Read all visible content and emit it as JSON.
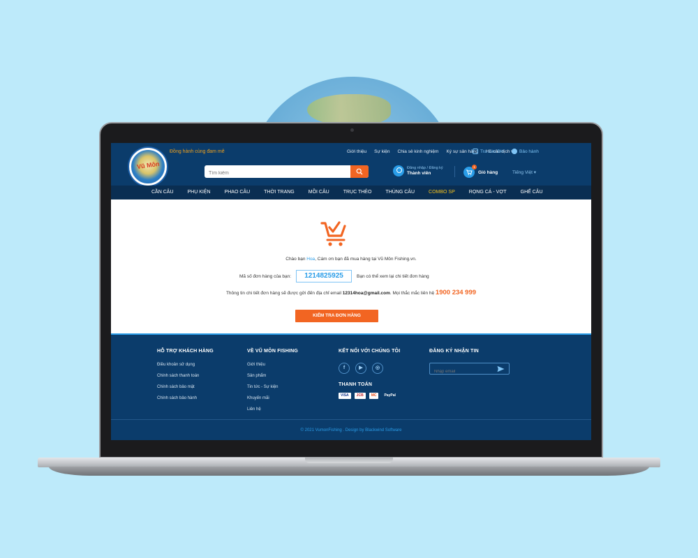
{
  "header": {
    "slogan": "Đồng hành cùng đam mê",
    "top_links": [
      "Giới thiệu",
      "Sự kiện",
      "Chia sẻ kinh nghiệm",
      "Ký sự sản hàng",
      "Hồ câu dịch vụ"
    ],
    "track_order": "Tra cứu ĐH",
    "warranty": "Bảo hành",
    "search_placeholder": "Tìm kiếm",
    "account_login": "Đăng nhập / Đăng ký",
    "account_label": "Thành viên",
    "cart_label": "Giỏ hàng",
    "cart_count": "1",
    "language": "Tiếng Việt"
  },
  "nav": {
    "items": [
      "CẦN CÂU",
      "PHỤ KIỆN",
      "PHAO CÂU",
      "THỜI TRANG",
      "MỒI CÂU",
      "TRỤC THẺO",
      "THÙNG CÂU",
      "COMBO SP",
      "RỌNG CÁ - VỢT",
      "GHẾ CÂU"
    ],
    "highlight_index": 7
  },
  "confirmation": {
    "greeting_prefix": "Chào bạn ",
    "customer_name": "Hoa",
    "greeting_suffix": ", Cám ơn bạn đã mua hàng tại Vũ Môn Fishing.vn.",
    "order_label": "Mã số đơn hàng của bạn:",
    "order_number": "1214825925",
    "order_hint": "Bạn có thể xem lại chi tiết đơn hàng",
    "info_prefix": "Thông tin chi tiết đơn hàng sẽ được gửi đến địa chỉ email ",
    "email": "12314hoa@gmail.com",
    "info_mid": ". Mọi thắc mắc liên hệ ",
    "phone": "1900 234 999",
    "button": "KIỂM TRA ĐƠN HÀNG"
  },
  "footer": {
    "support": {
      "title": "HỖ TRỢ KHÁCH HÀNG",
      "items": [
        "Điều khoản sử dụng",
        "Chính sách thanh toán",
        "Chính sách bảo mật",
        "Chính sách bảo hành"
      ]
    },
    "about": {
      "title": "VỀ VŨ MÔN FISHING",
      "items": [
        "Giới thiệu",
        "Sản phẩm",
        "Tin tức - Sự kiện",
        "Khuyến mãi",
        "Liên hệ"
      ]
    },
    "connect": {
      "title": "KẾT NỐI VỚI CHÚNG TÔI",
      "socials": [
        "f",
        "▶",
        "◎"
      ]
    },
    "payment": {
      "title": "THANH TOÁN",
      "methods": [
        "VISA",
        "JCB",
        "MC",
        "PayPal"
      ]
    },
    "newsletter": {
      "title": "ĐĂNG KÝ NHẬN TIN",
      "placeholder": "Nhập email"
    },
    "copyright": "© 2021 VumonFishing . Design by Blackwind Software"
  },
  "colors": {
    "primary_dark": "#0b3c6b",
    "accent_orange": "#f26522",
    "accent_blue": "#2a9de8",
    "highlight_yellow": "#f6c21c",
    "background": "#bdeafa"
  }
}
